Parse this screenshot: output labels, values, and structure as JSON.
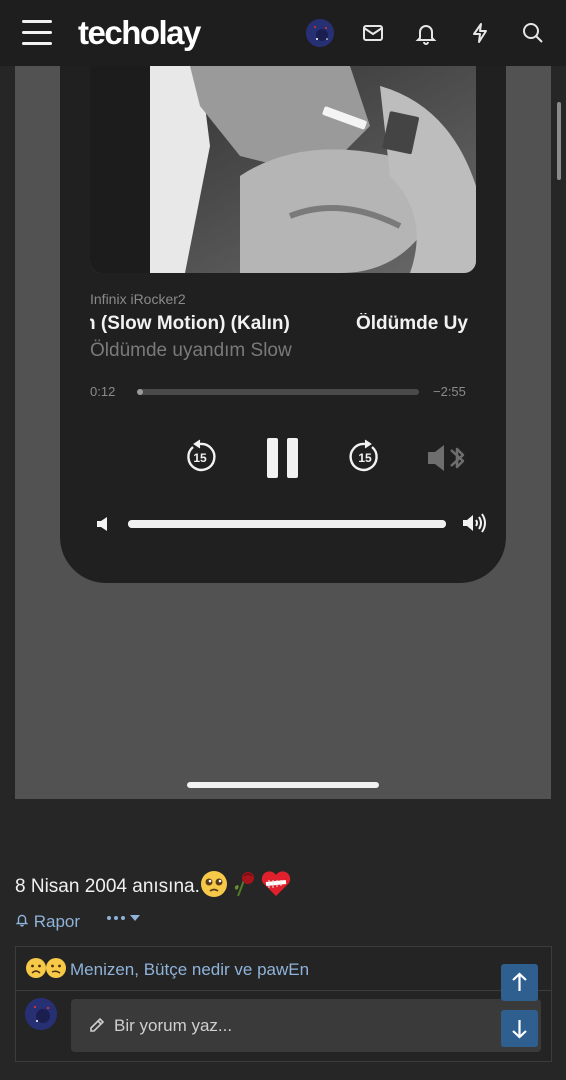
{
  "header": {
    "logo": "techolay",
    "icons": [
      "menu-icon",
      "avatar",
      "mail-icon",
      "bell-icon",
      "lightning-icon",
      "search-icon"
    ]
  },
  "player": {
    "device": "Infinix iRocker2",
    "track_title": "n (Slow Motion) (Kalın)",
    "track_title_next": "Öldümde Uy",
    "artist": "Öldümde uyandım Slow",
    "elapsed": "0:12",
    "remaining": "−2:55",
    "progress_fraction": 0.02,
    "volume_fraction": 1.0,
    "skip_back_seconds": "15",
    "skip_forward_seconds": "15"
  },
  "post": {
    "text": "8 Nisan 2004 anısına.",
    "report_label": "Rapor"
  },
  "reactions": {
    "text": "Menizen, Bütçe nedir ve pawEn"
  },
  "comment": {
    "placeholder": "Bir yorum yaz..."
  },
  "colors": {
    "accent_link": "#8fb3d9",
    "jump_button": "#2e5f8f",
    "header_bg": "#1e1e1e",
    "page_bg": "#262626"
  }
}
